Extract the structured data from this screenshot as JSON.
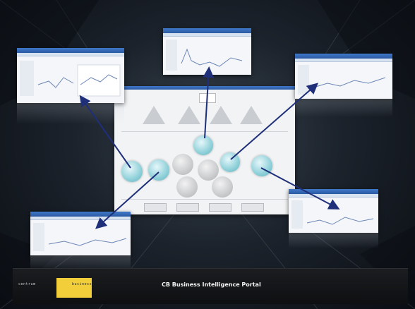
{
  "footer": {
    "logo_text_left": "centrum",
    "logo_text_right": "business",
    "title": "CB Business Intelligence Portal"
  },
  "colors": {
    "arrow": "#1f2f7a",
    "accent_yellow": "#f2cf3a",
    "teal_node": "#8fd0d9"
  },
  "icons": [
    "logo-icon",
    "arrow-icon"
  ]
}
